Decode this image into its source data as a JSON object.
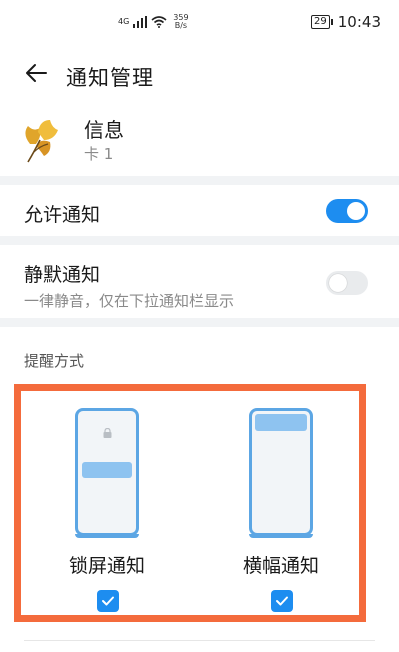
{
  "status_bar": {
    "network": "4G",
    "speed_value": "359",
    "speed_unit": "B/s",
    "battery": "29",
    "time": "10:43"
  },
  "header": {
    "title": "通知管理"
  },
  "app": {
    "name": "信息",
    "sub": "卡 1",
    "icon": "ginkgo-leaf-icon"
  },
  "settings": {
    "allow": {
      "label": "允许通知",
      "enabled": true
    },
    "silent": {
      "label": "静默通知",
      "description": "一律静音，仅在下拉通知栏显示",
      "enabled": false
    }
  },
  "reminder": {
    "section_label": "提醒方式",
    "options": [
      {
        "label": "锁屏通知",
        "checked": true
      },
      {
        "label": "横幅通知",
        "checked": true
      }
    ]
  },
  "colors": {
    "accent": "#1d8df0",
    "highlight": "#f46b3c",
    "phone_frame": "#5ca6e4"
  }
}
